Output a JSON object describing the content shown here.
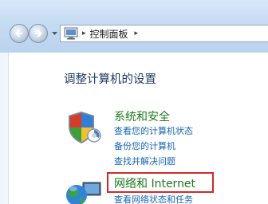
{
  "address": {
    "breadcrumb": "控制面板",
    "separator": "▸"
  },
  "page": {
    "title": "调整计算机的设置"
  },
  "categories": [
    {
      "title": "系统和安全",
      "links": [
        "查看您的计算机状态",
        "备份您的计算机",
        "查找并解决问题"
      ]
    },
    {
      "title": "网络和 Internet",
      "links": [
        "查看网络状态和任务"
      ]
    }
  ],
  "colors": {
    "category_title": "#1a7a1a",
    "link": "#1565b8",
    "highlight": "#d42828"
  },
  "icons": {
    "back": "back-arrow-icon",
    "forward": "forward-arrow-icon",
    "control_panel": "control-panel-icon",
    "security": "shield-icon",
    "network": "network-globe-icon"
  }
}
